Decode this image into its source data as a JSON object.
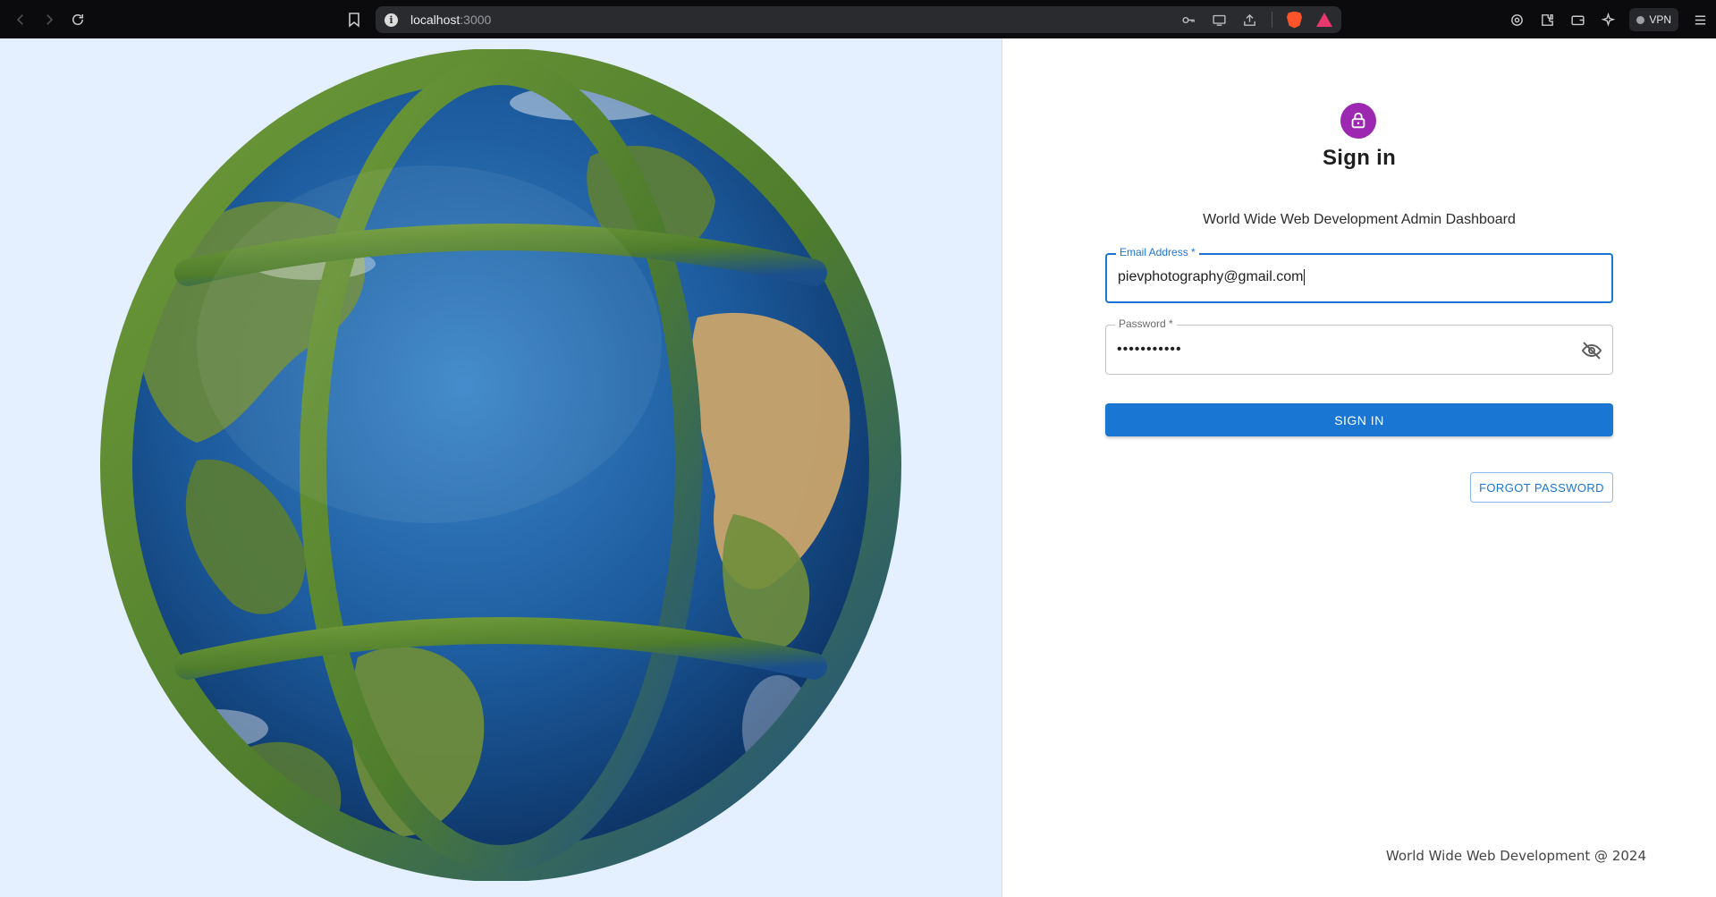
{
  "browser": {
    "url_host": "localhost",
    "url_port": ":3000",
    "vpn_label": "VPN"
  },
  "signin": {
    "title": "Sign in",
    "subtitle": "World Wide Web Development Admin Dashboard",
    "email_label": "Email Address *",
    "email_value": "pievphotography@gmail.com",
    "password_label": "Password *",
    "password_value": "•••••••••••",
    "submit_label": "SIGN IN",
    "forgot_label": "FORGOT PASSWORD"
  },
  "footer": {
    "text": "World Wide Web Development @ 2024"
  },
  "colors": {
    "accent": "#1976d2",
    "avatar": "#9c27b0",
    "left_panel_bg": "#e4efff"
  },
  "icons": [
    "back-icon",
    "forward-icon",
    "reload-icon",
    "bookmark-icon",
    "site-info-icon",
    "key-icon",
    "cast-icon",
    "share-icon",
    "brave-shields-icon",
    "brave-rewards-icon",
    "leo-icon",
    "extensions-icon",
    "wallet-icon",
    "ai-icon",
    "menu-icon",
    "lock-icon",
    "visibility-off-icon",
    "globe-image"
  ]
}
